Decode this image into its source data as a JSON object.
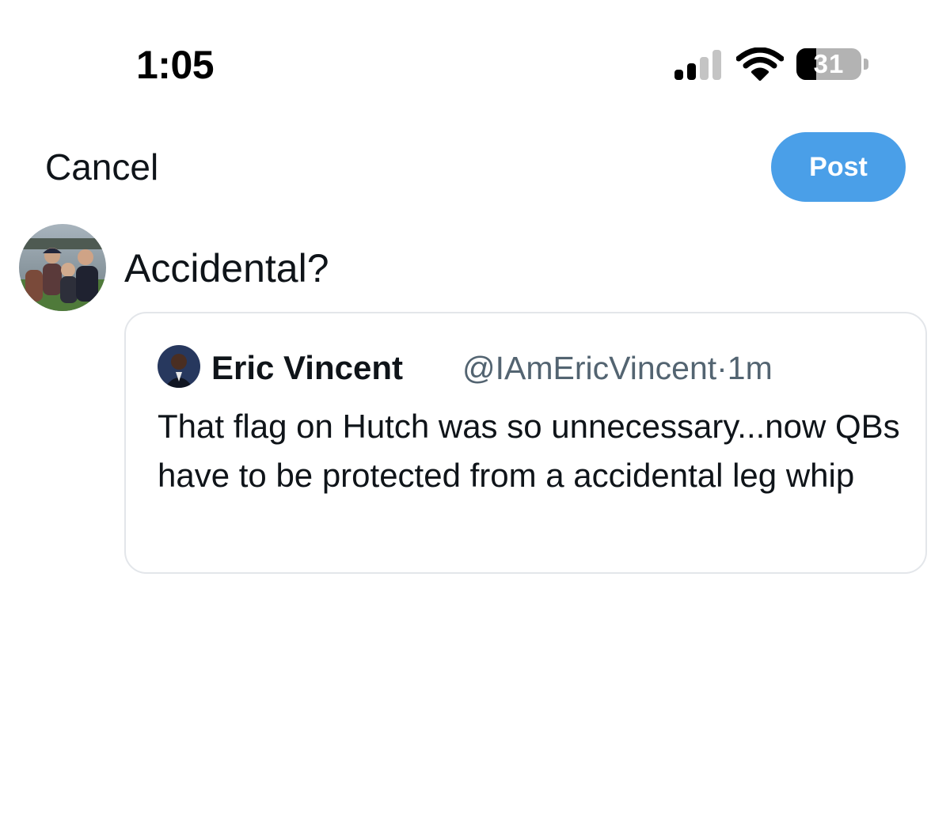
{
  "status_bar": {
    "time": "1:05",
    "signal_bars_active": 2,
    "signal_bars_total": 4,
    "battery_percent": 31,
    "battery_label": "31",
    "icons": [
      "cellular-signal-icon",
      "wifi-icon",
      "battery-icon"
    ]
  },
  "header": {
    "cancel_label": "Cancel",
    "post_label": "Post",
    "post_color": "#4a9fe8"
  },
  "composer": {
    "text": "Accidental?",
    "avatar_icon": "user-avatar-photo"
  },
  "quote": {
    "name": "Eric Vincent",
    "meta": "@IAmEricVincent·1m",
    "body": "That flag on Hutch was so unnecessary...now QBs have to be protected from a accidental leg whip",
    "avatar_icon": "quoted-author-avatar-photo"
  },
  "colors": {
    "text_primary": "#0f1419",
    "text_secondary": "#536471",
    "card_border": "#e3e6ea"
  }
}
